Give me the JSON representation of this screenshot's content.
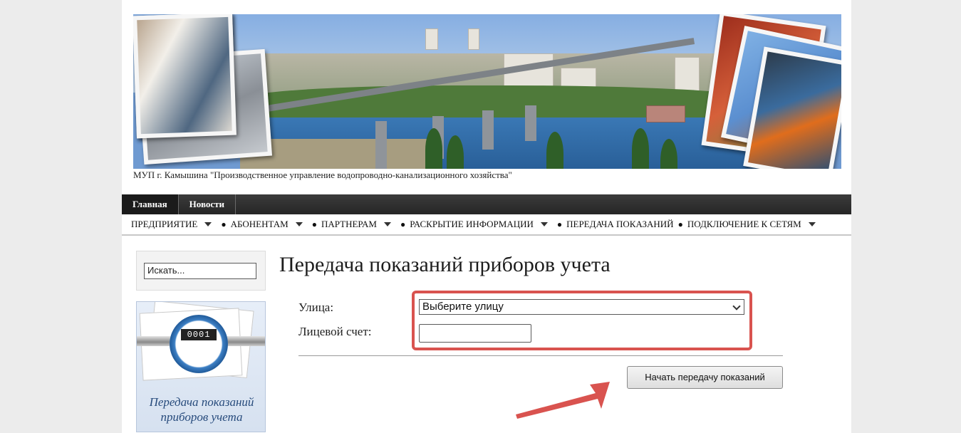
{
  "header": {
    "organization": "МУП г. Камышина \"Производственное управление водопроводно-канализационного хозяйства\""
  },
  "nav_top": {
    "items": [
      {
        "label": "Главная"
      },
      {
        "label": "Новости"
      }
    ]
  },
  "nav_menu": {
    "items": [
      {
        "label": "ПРЕДПРИЯТИЕ",
        "has_dropdown": true
      },
      {
        "label": "АБОНЕНТАМ",
        "has_dropdown": true
      },
      {
        "label": "ПАРТНЕРАМ",
        "has_dropdown": true
      },
      {
        "label": "РАСКРЫТИЕ ИНФОРМАЦИИ",
        "has_dropdown": true
      },
      {
        "label": "ПЕРЕДАЧА ПОКАЗАНИЙ",
        "has_dropdown": false
      },
      {
        "label": "ПОДКЛЮЧЕНИЕ К СЕТЯМ",
        "has_dropdown": true
      }
    ]
  },
  "sidebar": {
    "search_value": "Искать...",
    "meter_digits": "0001",
    "banner_caption_line1": "Передача показаний",
    "banner_caption_line2": "приборов учета"
  },
  "main": {
    "title": "Передача показаний приборов учета",
    "street_label": "Улица:",
    "street_selected": "Выберите улицу",
    "account_label": "Лицевой счет:",
    "account_value": "",
    "submit_label": "Начать передачу показаний"
  },
  "colors": {
    "highlight": "#d9534f",
    "nav_dark": "#2b2b2b",
    "accent_blue": "#274b7c"
  }
}
